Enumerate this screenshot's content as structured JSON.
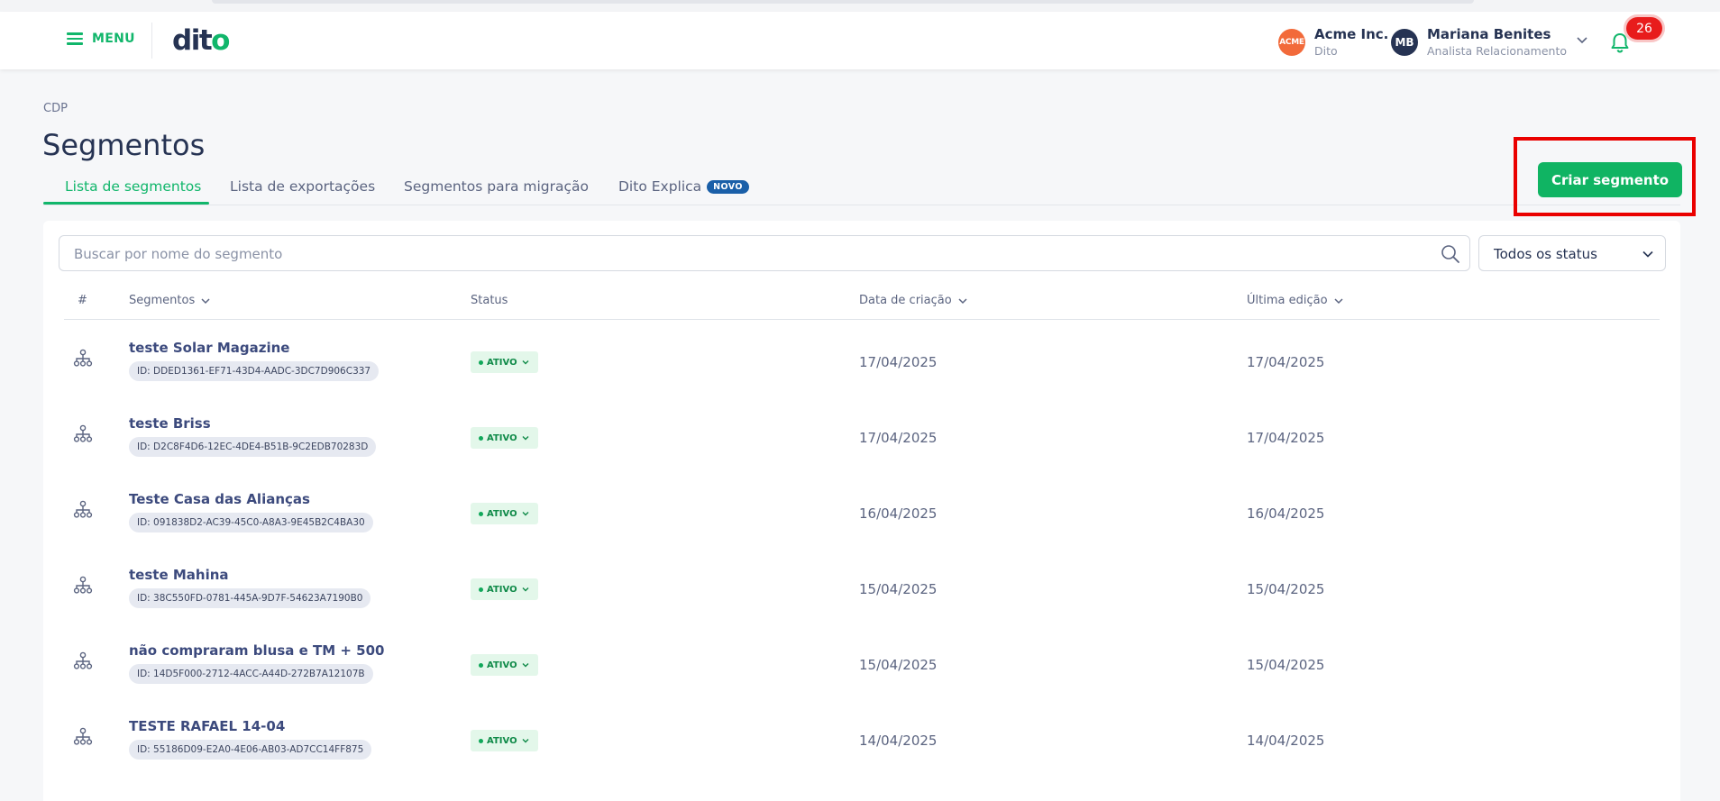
{
  "header": {
    "menu_label": "MENU",
    "logo_text": "dit",
    "logo_dot_text": "o",
    "company": {
      "logo_text": "ACME",
      "name": "Acme Inc.",
      "sub": "Dito"
    },
    "user": {
      "initials": "MB",
      "name": "Mariana Benites",
      "role": "Analista Relacionamento"
    },
    "notifications_count": "26"
  },
  "breadcrumb": "CDP",
  "page_title": "Segmentos",
  "tabs": [
    {
      "label": "Lista de segmentos",
      "active": true
    },
    {
      "label": "Lista de exportações",
      "active": false
    },
    {
      "label": "Segmentos para migração",
      "active": false
    },
    {
      "label": "Dito Explica",
      "active": false,
      "badge": "NOVO"
    }
  ],
  "create_button_label": "Criar segmento",
  "search": {
    "placeholder": "Buscar por nome do segmento"
  },
  "status_filter": {
    "value": "Todos os status"
  },
  "table": {
    "columns": [
      "#",
      "Segmentos",
      "Status",
      "Data de criação",
      "Última edição"
    ],
    "rows": [
      {
        "name": "teste Solar Magazine",
        "id": "ID: DDED1361-EF71-43D4-AADC-3DC7D906C337",
        "status": "ATIVO",
        "created": "17/04/2025",
        "edited": "17/04/2025"
      },
      {
        "name": "teste Briss",
        "id": "ID: D2C8F4D6-12EC-4DE4-B51B-9C2EDB70283D",
        "status": "ATIVO",
        "created": "17/04/2025",
        "edited": "17/04/2025"
      },
      {
        "name": "Teste Casa das Alianças",
        "id": "ID: 091838D2-AC39-45C0-A8A3-9E45B2C4BA30",
        "status": "ATIVO",
        "created": "16/04/2025",
        "edited": "16/04/2025"
      },
      {
        "name": "teste Mahina",
        "id": "ID: 38C550FD-0781-445A-9D7F-54623A7190B0",
        "status": "ATIVO",
        "created": "15/04/2025",
        "edited": "15/04/2025"
      },
      {
        "name": "não compraram blusa e TM + 500",
        "id": "ID: 14D5F000-2712-4ACC-A44D-272B7A12107B",
        "status": "ATIVO",
        "created": "15/04/2025",
        "edited": "15/04/2025"
      },
      {
        "name": "TESTE RAFAEL 14-04",
        "id": "ID: 55186D09-E2A0-4E06-AB03-AD7CC14FF875",
        "status": "ATIVO",
        "created": "14/04/2025",
        "edited": "14/04/2025"
      }
    ]
  },
  "colors": {
    "accent": "#10b463",
    "brand_navy": "#263353",
    "highlight": "#ea0000",
    "badge": "#e81c1c"
  },
  "icons": [
    "hamburger-icon",
    "chevron-down-icon",
    "bell-icon",
    "search-icon",
    "segment-icon"
  ]
}
